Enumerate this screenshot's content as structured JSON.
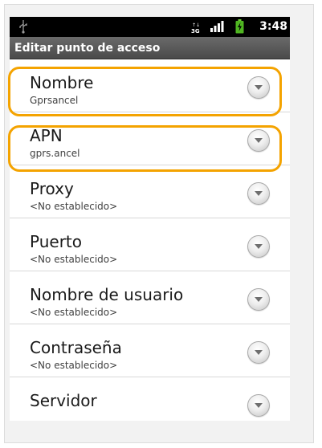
{
  "status_bar": {
    "time": "3:48",
    "network_type": "3G",
    "icons": [
      "usb-icon",
      "network-3g-icon",
      "signal-icon",
      "battery-charging-icon"
    ]
  },
  "header": {
    "title": "Editar punto de acceso"
  },
  "fields": [
    {
      "label": "Nombre",
      "value": "Gprsancel",
      "highlighted": true
    },
    {
      "label": "APN",
      "value": "gprs.ancel",
      "highlighted": true
    },
    {
      "label": "Proxy",
      "value": "<No establecido>"
    },
    {
      "label": "Puerto",
      "value": "<No establecido>"
    },
    {
      "label": "Nombre de usuario",
      "value": "<No establecido>"
    },
    {
      "label": "Contraseña",
      "value": "<No establecido>"
    },
    {
      "label": "Servidor",
      "value": ""
    }
  ],
  "colors": {
    "highlight": "#f4a300",
    "status_bar": "#000000",
    "title_bar": "#555555",
    "frame": "#f2f2f2"
  }
}
